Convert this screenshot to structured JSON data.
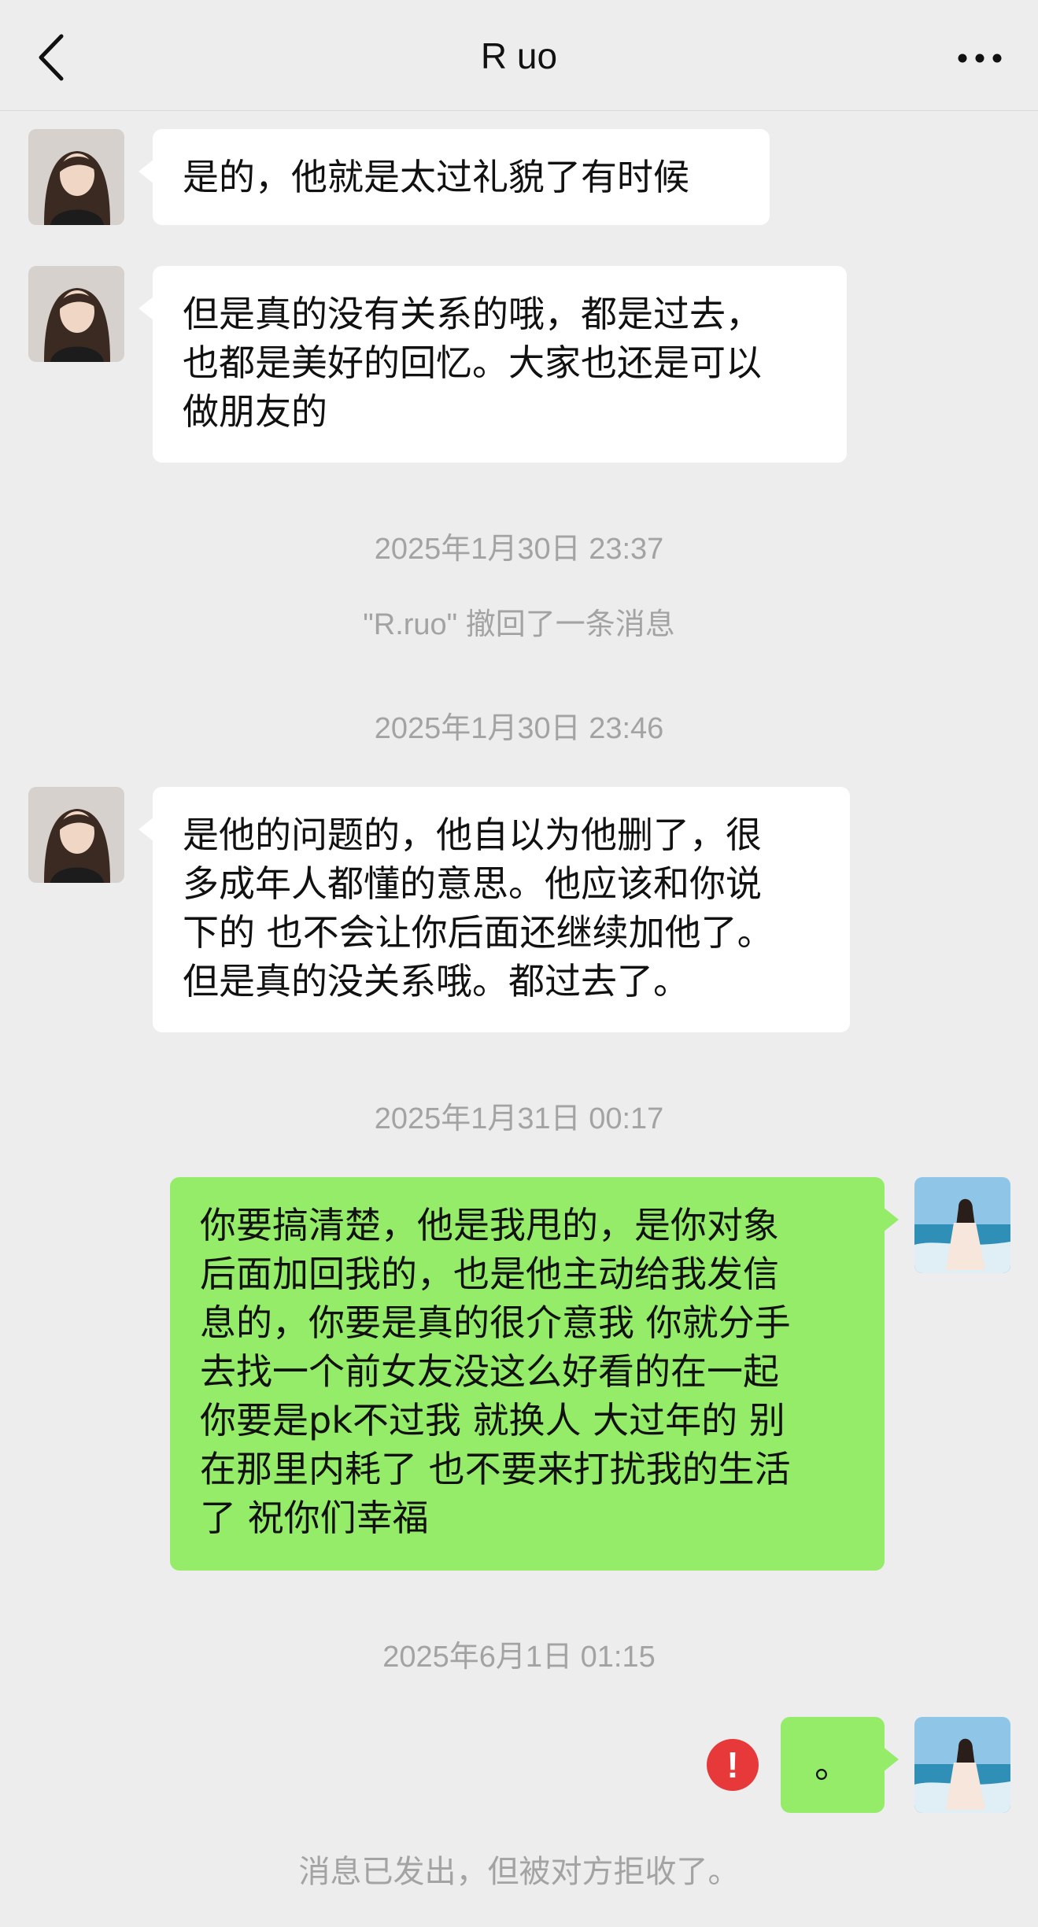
{
  "header": {
    "title": "R uo",
    "back_icon": "chevron-left-icon",
    "more_icon": "more-horizontal-icon"
  },
  "messages": [
    {
      "from": "them",
      "text": "是的，他就是太过礼貌了有时候"
    },
    {
      "from": "them",
      "text": "但是真的没有关系的哦，都是过去，\n也都是美好的回忆。大家也还是可以\n做朋友的"
    },
    {
      "type": "time",
      "text": "2025年1月30日 23:37"
    },
    {
      "type": "system",
      "text": "\"R.ruo\" 撤回了一条消息"
    },
    {
      "type": "time",
      "text": "2025年1月30日 23:46"
    },
    {
      "from": "them",
      "text": "是他的问题的，他自以为他删了，很\n多成年人都懂的意思。他应该和你说\n下的 也不会让你后面还继续加他了。\n但是真的没关系哦。都过去了。"
    },
    {
      "type": "time",
      "text": "2025年1月31日 00:17"
    },
    {
      "from": "me",
      "text": "你要搞清楚，他是我甩的，是你对象\n后面加回我的，也是他主动给我发信\n息的，你要是真的很介意我 你就分手\n去找一个前女友没这么好看的在一起\n你要是pk不过我 就换人 大过年的 别\n在那里内耗了 也不要来打扰我的生活\n了 祝你们幸福"
    },
    {
      "type": "time",
      "text": "2025年6月1日 01:15"
    },
    {
      "from": "me",
      "text": "。",
      "failed": true,
      "error_mark": "!"
    },
    {
      "type": "system",
      "text": "消息已发出，但被对方拒收了。"
    }
  ],
  "colors": {
    "background": "#ededed",
    "bubble_in": "#ffffff",
    "bubble_out": "#95ec69",
    "error": "#e8393a",
    "meta_text": "#a3a3a3"
  }
}
